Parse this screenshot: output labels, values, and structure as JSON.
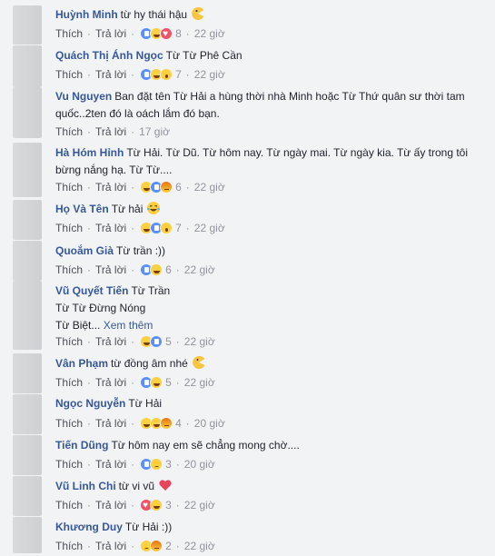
{
  "labels": {
    "like": "Thích",
    "reply": "Trả lời",
    "sep": "·"
  },
  "colors": {
    "name": "#365899",
    "meta": "#90949c",
    "background": "#f2f3f5"
  },
  "comments": [
    {
      "name": "Huỳnh Minh",
      "text": "từ hy thái hậu",
      "emoji": "pacman-moon-icon",
      "reactions": [
        "like",
        "haha",
        "love"
      ],
      "count": "8",
      "time": "22 giờ"
    },
    {
      "name": "Quách Thị Ánh Ngọc",
      "text": "Từ Từ Phê Cần",
      "reactions": [
        "like",
        "haha",
        "wow"
      ],
      "count": "7",
      "time": "22 giờ"
    },
    {
      "name": "Vu Nguyen",
      "text": "Ban đặt tên Từ Hải a hùng thời nhà Minh hoặc Từ Thứ quân sư thời tam quốc..2ten đó là oách lắm đó bạn.",
      "reactions": [],
      "count": "",
      "time": "17 giờ"
    },
    {
      "name": "Hà Hóm Hỉnh",
      "text": "Từ Hải. Từ Dũ. Từ hôm nay. Từ ngày mai. Từ ngày kia. Từ ấy trong tôi bừng nắng hạ. Từ Từ....",
      "reactions": [
        "haha",
        "like",
        "angry"
      ],
      "count": "6",
      "time": "22 giờ"
    },
    {
      "name": "Họ Và Tên",
      "text": "Từ hải",
      "emoji": "laughing-face-icon",
      "reactions": [
        "haha",
        "like",
        "wow"
      ],
      "count": "7",
      "time": "22 giờ"
    },
    {
      "name": "Quoắm Già",
      "text": "Từ trần :))",
      "reactions": [
        "like",
        "haha"
      ],
      "count": "6",
      "time": "22 giờ"
    },
    {
      "name": "Vũ Quyết Tiến",
      "text": "Từ Trần",
      "text2": "Từ Từ Đừng Nóng",
      "text3": "Từ Biệt...",
      "see_more": "Xem thêm",
      "reactions": [
        "haha",
        "like"
      ],
      "count": "5",
      "time": "22 giờ"
    },
    {
      "name": "Vân Phạm",
      "text": "từ đồng âm nhé",
      "emoji": "pacman-moon-icon",
      "reactions": [
        "like",
        "haha"
      ],
      "count": "5",
      "time": "22 giờ"
    },
    {
      "name": "Ngọc Nguyễn",
      "text": "Từ Hải",
      "reactions": [
        "haha",
        "haha",
        "angry"
      ],
      "count": "4",
      "time": "20 giờ"
    },
    {
      "name": "Tiến Dũng",
      "text": "Từ hôm nay em sẽ chẳng mong chờ....",
      "reactions": [
        "like",
        "sad"
      ],
      "count": "3",
      "time": "20 giờ"
    },
    {
      "name": "Vũ Linh Chi",
      "text": "từ vi vũ",
      "emoji": "heart-icon",
      "reactions": [
        "love",
        "haha"
      ],
      "count": "3",
      "time": "22 giờ"
    },
    {
      "name": "Khương Duy",
      "text": "Từ Hải :))",
      "reactions": [
        "sad",
        "angry"
      ],
      "count": "2",
      "time": "22 giờ"
    }
  ]
}
